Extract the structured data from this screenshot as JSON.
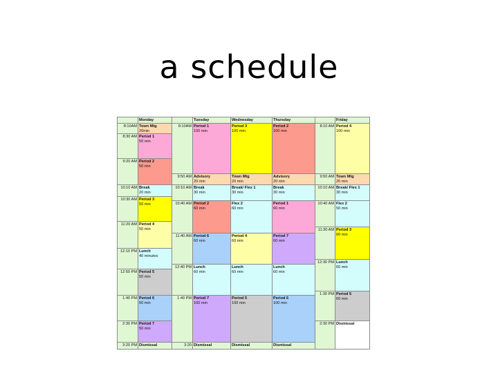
{
  "slide": {
    "title": "a schedule"
  },
  "colors": {
    "green": "#e0f7d4",
    "orange": "#fdd9b0",
    "pink": "#fca9d7",
    "red": "#fc9a8e",
    "yellow": "#ffff00",
    "lightyellow": "#fefea6",
    "cyan": "#d3fcfc",
    "blue": "#a9d1fa",
    "grey": "#cdcdcd",
    "purple": "#cfa9fb",
    "white": "#ffffff"
  },
  "schedule": {
    "headers": {
      "monday": "Monday",
      "tuesday": "Tuesday",
      "wednesday": "Wednesday",
      "thursday": "Thursday",
      "friday": "Friday"
    },
    "monday_times": [
      "8:10AM",
      "8:30 AM",
      "9:20 AM",
      "10:10 AM",
      "10:30 AM",
      "11:20 AM",
      "12:10 PM",
      "12:50 PM",
      "1:40 PM",
      "2:30 PM",
      "3:20 PM"
    ],
    "monday": [
      {
        "name": "Town Mtg",
        "duration": "20min",
        "color": "orange"
      },
      {
        "name": "Period 1",
        "duration": "50 min",
        "color": "pink"
      },
      {
        "name": "Period 2",
        "duration": "50 min",
        "color": "red"
      },
      {
        "name": "Break",
        "duration": "20 min",
        "color": "cyan"
      },
      {
        "name": "Period 3",
        "duration": "50 min",
        "color": "yellow"
      },
      {
        "name": "Period 4",
        "duration": "50 min",
        "color": "lightyellow"
      },
      {
        "name": "Lunch",
        "duration": "40 minutes",
        "color": "cyan"
      },
      {
        "name": "Period 5",
        "duration": "50 min",
        "color": "grey"
      },
      {
        "name": "Period 6",
        "duration": "50 min",
        "color": "blue"
      },
      {
        "name": "Period 7",
        "duration": "50 min",
        "color": "purple"
      },
      {
        "name": "Dismissal",
        "duration": "",
        "color": "green"
      }
    ],
    "tuesday_times": [
      "8:10AM",
      "9:50 AM",
      "10:10 AM",
      "10:40 AM",
      "11:40 AM",
      "12:40 PM",
      "1:40 PM",
      "3:20"
    ],
    "tuesday": [
      {
        "name": "Period 1",
        "duration": "100 min",
        "color": "pink"
      },
      {
        "name": "Advisory",
        "duration": "20 min",
        "color": "orange"
      },
      {
        "name": "Break",
        "duration": "30 min",
        "color": "cyan"
      },
      {
        "name": "Period 2",
        "duration": "60 min",
        "color": "red"
      },
      {
        "name": "Period 6",
        "duration": "60 min",
        "color": "blue"
      },
      {
        "name": "Lunch",
        "duration": "60 min",
        "color": "cyan"
      },
      {
        "name": "Period 7",
        "duration": "100 min",
        "color": "purple"
      },
      {
        "name": "Dismissal",
        "duration": "",
        "color": "green"
      }
    ],
    "wednesday": [
      {
        "name": "Period 3",
        "duration": "100 min",
        "color": "yellow"
      },
      {
        "name": "Town Mtg",
        "duration": "20 min",
        "color": "orange"
      },
      {
        "name": "Break/ Flex 1",
        "duration": "30 min",
        "color": "cyan"
      },
      {
        "name": "Flex 2",
        "duration": "60 min",
        "color": "cyan"
      },
      {
        "name": "Period 4",
        "duration": "60 min",
        "color": "lightyellow"
      },
      {
        "name": "Lunch",
        "duration": "60 min",
        "color": "cyan"
      },
      {
        "name": "Period 5",
        "duration": "100 min",
        "color": "grey"
      },
      {
        "name": "Dismissal",
        "duration": "",
        "color": "green"
      }
    ],
    "thursday": [
      {
        "name": "Period 2",
        "duration": "100 min",
        "color": "red"
      },
      {
        "name": "Advisory",
        "duration": "20 min",
        "color": "orange"
      },
      {
        "name": "Break",
        "duration": "30 min",
        "color": "cyan"
      },
      {
        "name": "Period 1",
        "duration": "60 min",
        "color": "pink"
      },
      {
        "name": "Period 7",
        "duration": "60 min",
        "color": "purple"
      },
      {
        "name": "Lunch",
        "duration": "60 min",
        "color": "cyan"
      },
      {
        "name": "Period 6",
        "duration": "100 min",
        "color": "blue"
      },
      {
        "name": "Dismissal",
        "duration": "",
        "color": "green"
      }
    ],
    "friday_times": [
      "8:10 AM",
      "9:50 AM",
      "10:10 AM",
      "10:40 AM",
      "11:30 AM",
      "12:30 PM",
      "1:30 PM",
      "2:30 PM"
    ],
    "friday": [
      {
        "name": "Period 4",
        "duration": "100 min",
        "color": "lightyellow"
      },
      {
        "name": "Town Mtg",
        "duration": "20 min",
        "color": "orange"
      },
      {
        "name": "Break/ Flex 1",
        "duration": "30 min",
        "color": "cyan"
      },
      {
        "name": "Flex 2",
        "duration": "50 min",
        "color": "cyan"
      },
      {
        "name": "Period 3",
        "duration": "60 min",
        "color": "yellow"
      },
      {
        "name": "Lunch",
        "duration": "60 min",
        "color": "cyan"
      },
      {
        "name": "Period 5",
        "duration": "60 min",
        "color": "grey"
      },
      {
        "name": "Dismissal",
        "duration": "",
        "color": "white"
      }
    ]
  }
}
